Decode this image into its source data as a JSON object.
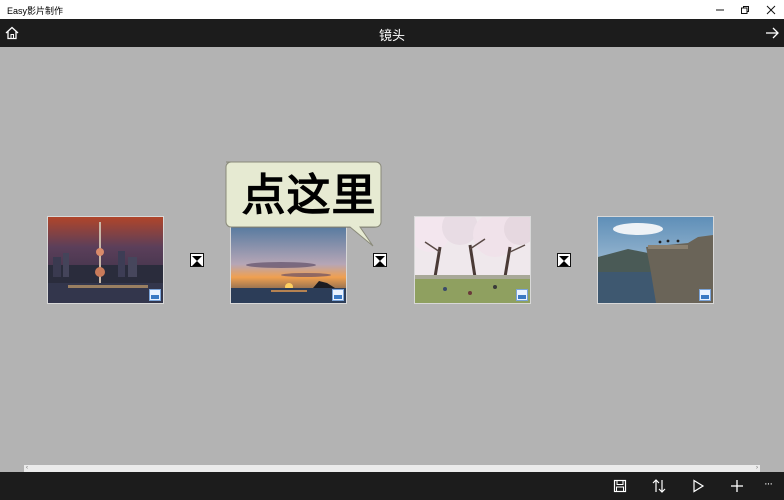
{
  "window": {
    "title": "Easy影片制作"
  },
  "header": {
    "title": "镜头"
  },
  "callout": {
    "text": "点这里"
  },
  "clips": [
    {
      "name": "night-city"
    },
    {
      "name": "sunset-sea"
    },
    {
      "name": "cherry-blossoms"
    },
    {
      "name": "cliff-fjord"
    }
  ],
  "scroll": {
    "left_arrow": "‹",
    "right_arrow": "›"
  },
  "bottombar": {
    "more_label": "···"
  },
  "icons": {
    "home": "home-icon",
    "forward": "arrow-right-icon",
    "save": "save-icon",
    "sort": "sort-icon",
    "play": "play-icon",
    "add": "plus-icon",
    "more": "more-icon"
  }
}
